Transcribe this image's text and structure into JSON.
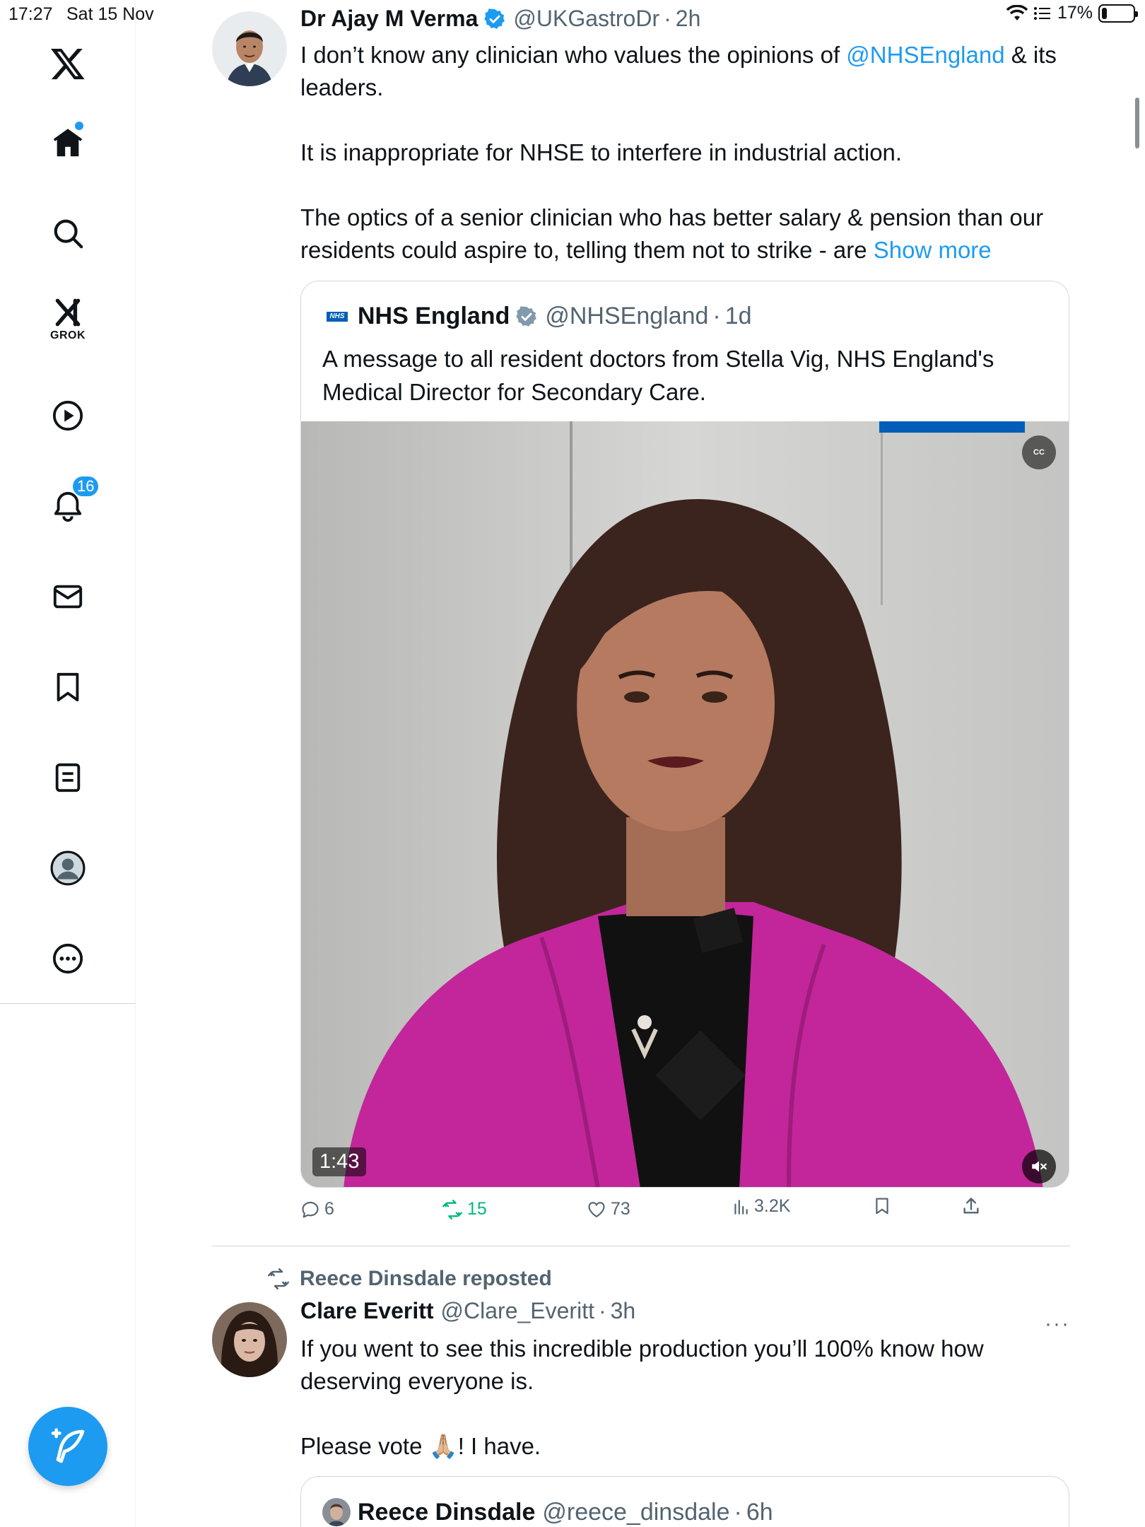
{
  "status_bar": {
    "time": "17:27",
    "date": "Sat 15 Nov",
    "battery": "17%",
    "battery_level": 0.17
  },
  "nav": {
    "items": [
      {
        "name": "x-logo",
        "icon": "x-logo-icon"
      },
      {
        "name": "home",
        "icon": "home-icon",
        "has_dot": true
      },
      {
        "name": "explore",
        "icon": "search-icon"
      },
      {
        "name": "grok",
        "icon": "grok-icon",
        "label": "GROK"
      },
      {
        "name": "video",
        "icon": "play-icon"
      },
      {
        "name": "notifications",
        "icon": "bell-icon",
        "badge": "16"
      },
      {
        "name": "messages",
        "icon": "mail-icon"
      },
      {
        "name": "bookmarks",
        "icon": "bookmark-icon"
      },
      {
        "name": "lists",
        "icon": "list-icon"
      },
      {
        "name": "profile",
        "icon": "profile-icon"
      },
      {
        "name": "more",
        "icon": "more-icon"
      }
    ],
    "compose_icon": "compose-feather-icon"
  },
  "tweet1": {
    "author": "Dr Ajay M Verma",
    "handle": "@UKGastroDr",
    "time": "2h",
    "text_line1_a": "I don’t know any clinician who values the opinions of ",
    "mention": "@NHSEngland",
    "text_line1_b": " & its leaders.",
    "text_para2": "It is inappropriate for NHSE to interfere in industrial action.",
    "text_para3": "The optics of a senior clinician who has better salary & pension than our residents could aspire to, telling them not to strike - are ",
    "show_more": "Show more",
    "quote": {
      "logo_text": "NHS",
      "author": "NHS England",
      "handle": "@NHSEngland",
      "time": "1d",
      "text": "A message to all resident doctors from Stella Vig, NHS England's Medical Director for Secondary Care.",
      "video_duration": "1:43",
      "cc_label": "CC"
    },
    "actions": {
      "replies": "6",
      "reposts": "15",
      "likes": "73",
      "views": "3.2K"
    }
  },
  "tweet2": {
    "repost_by": "Reece Dinsdale reposted",
    "author": "Clare Everitt",
    "handle": "@Clare_Everitt",
    "time": "3h",
    "text_para1": "If you went to see this incredible production you’ll 100% know how deserving everyone is.",
    "text_para2": "Please vote 🙏🏼! I have.",
    "more": "···",
    "quote": {
      "author": "Reece Dinsdale",
      "handle": "@reece_dinsdale",
      "time": "6h"
    }
  },
  "colors": {
    "accent": "#1d9bf0",
    "text": "#0f1419",
    "secondary": "#536471",
    "repost_green": "#00ba7c",
    "border": "#cfd9de",
    "nhs_blue": "#005eb8",
    "video_jacket": "#c2269a"
  }
}
